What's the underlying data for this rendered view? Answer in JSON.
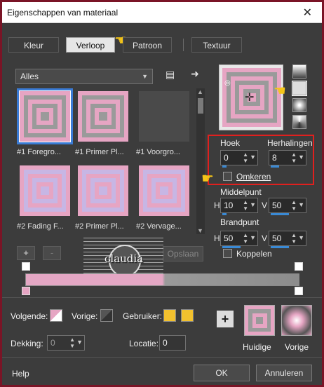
{
  "window": {
    "title": "Eigenschappen van materiaal",
    "close_glyph": "✕"
  },
  "tabs": [
    {
      "label": "Kleur",
      "active": false
    },
    {
      "label": "Verloop",
      "active": true
    },
    {
      "label": "Patroon",
      "active": false
    },
    {
      "label": "Textuur",
      "active": false
    }
  ],
  "category_select": {
    "value": "Alles"
  },
  "gradients": [
    {
      "label": "#1 Foregro...",
      "selected": true,
      "kind": "pink-gray-concentric"
    },
    {
      "label": "#1 Primer Pl...",
      "selected": false,
      "kind": "pink-gray-concentric"
    },
    {
      "label": "#1 Voorgro...",
      "selected": false,
      "kind": "empty"
    },
    {
      "label": "#2 Fading F...",
      "selected": false,
      "kind": "pink-lavender-concentric"
    },
    {
      "label": "#2 Primer Pl...",
      "selected": false,
      "kind": "pink-lavender-concentric"
    },
    {
      "label": "#2 Vervage...",
      "selected": false,
      "kind": "pink-lavender-concentric"
    }
  ],
  "settings": {
    "angle_label": "Hoek",
    "angle_value": "0",
    "repeats_label": "Herhalingen",
    "repeats_value": "8",
    "invert_label": "Omkeren",
    "invert_checked": false,
    "center_label": "Middelpunt",
    "center_h_label": "H",
    "center_h_value": "10",
    "center_v_label": "V",
    "center_v_value": "50",
    "focal_label": "Brandpunt",
    "focal_h_label": "H",
    "focal_h_value": "50",
    "focal_v_label": "V",
    "focal_v_value": "50",
    "link_label": "Koppelen",
    "link_checked": false
  },
  "editor": {
    "add_label": "+",
    "remove_label": "-",
    "save_label": "Opslaan",
    "watermark_text": "claudia"
  },
  "bottom": {
    "next_label": "Volgende:",
    "prev_label": "Vorige:",
    "user_label": "Gebruiker:",
    "opacity_label": "Dekking:",
    "opacity_value": "0",
    "location_label": "Locatie:",
    "location_value": "0",
    "add_swatch_label": "+",
    "current_label": "Huidige",
    "previous_label": "Vorige",
    "user_color_1": "#f2c12e",
    "user_color_2": "#f2c12e"
  },
  "footer": {
    "help_label": "Help",
    "ok_label": "OK",
    "cancel_label": "Annuleren"
  },
  "colors": {
    "pink": "#e6a5c3",
    "gray": "#9a9a9a",
    "lavender": "#c7b6e4",
    "accent": "#3a7bd5",
    "highlight": "#e0201e"
  },
  "icons": [
    "hand-pointer-icon",
    "book-icon",
    "arrow-right-icon",
    "crosshair-icon",
    "checkbox-icon"
  ]
}
